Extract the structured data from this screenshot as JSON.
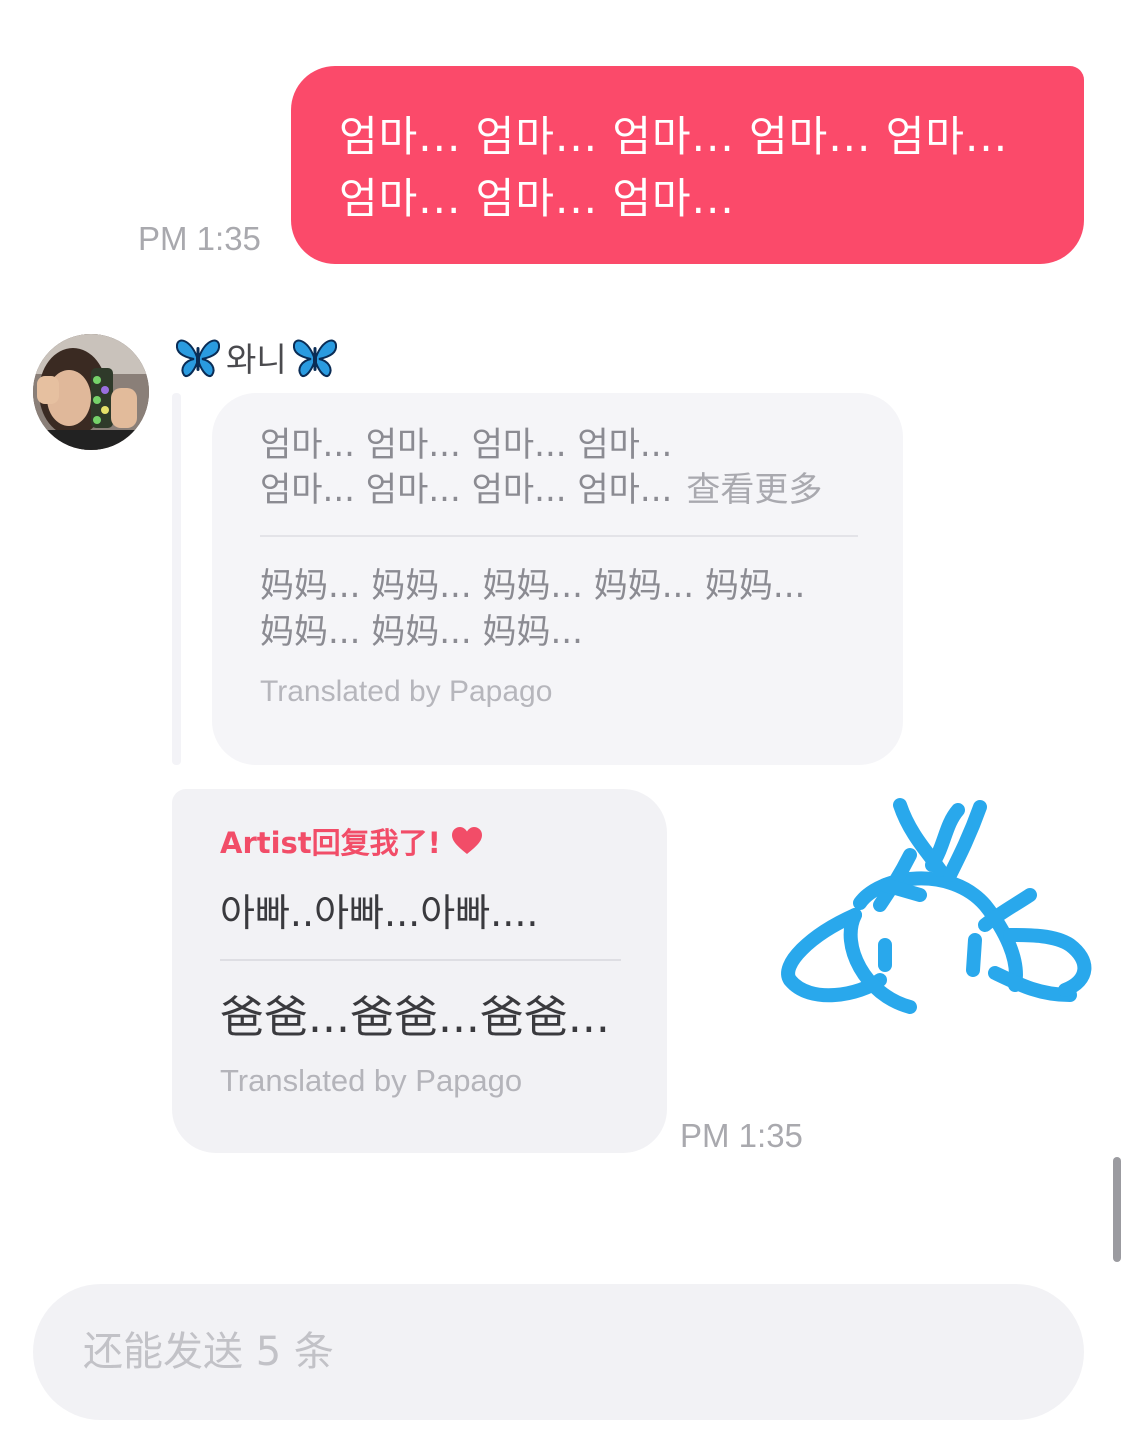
{
  "outgoing": {
    "text": "엄마... 엄마... 엄마... 엄마... 엄마... 엄마... 엄마... 엄마...",
    "time": "PM 1:35",
    "bubble_color": "#fb4a6a"
  },
  "sender": {
    "name": "와니",
    "decoration_icon": "butterfly-icon",
    "avatar_icon": "avatar-photo"
  },
  "quoted_message": {
    "original_line1": "엄마... 엄마... 엄마... 엄마...",
    "original_line2": "엄마... 엄마... 엄마... 엄마...",
    "see_more": "查看更多",
    "translation_line1": "妈妈... 妈妈... 妈妈... 妈妈... 妈妈...",
    "translation_line2": "妈妈... 妈妈... 妈妈...",
    "translated_by": "Translated by Papago"
  },
  "reply": {
    "header": "Artist回复我了!",
    "header_icon": "heart-icon",
    "accent_color": "#f24d68",
    "text": "아빠..아빠...아빠....",
    "translation": "爸爸...爸爸...爸爸...",
    "translated_by": "Translated by Papago",
    "time": "PM 1:35"
  },
  "doodle": {
    "icon": "doodle-drawing",
    "color": "#29a8ec"
  },
  "input": {
    "placeholder": "还能发送 5 条",
    "value": ""
  }
}
